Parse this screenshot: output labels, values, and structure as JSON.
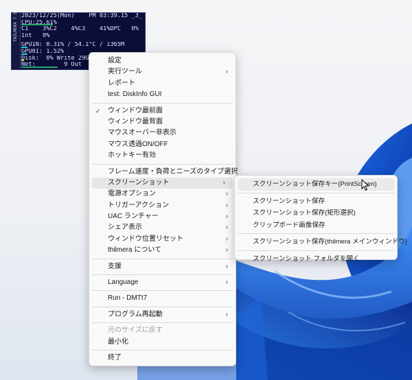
{
  "monitor": {
    "side_label": "THILMERA 7.5",
    "rows": [
      {
        "text": "2023/12/25(Mon)    PM 03:39.15 _3_"
      },
      {
        "text": "CPU:25.61%",
        "bar": 0.26,
        "color": "green"
      },
      {
        "text": "C1    3%C2    4%C3    41%DPC   0%"
      },
      {
        "text": "Int   0%"
      },
      {
        "gap": true
      },
      {
        "text": "GPU1N: 0.31% / 54.1°C / 1365M",
        "bar": 0.05,
        "color": "cyan"
      },
      {
        "text": "GPU0I: 1.52%",
        "bar": 0.05,
        "color": "cyan"
      },
      {
        "text": "Disk:  0% Write 29G",
        "bar": 0.02,
        "color": "yellow"
      },
      {
        "text": "Net:        9 Out",
        "bar": 0.3,
        "color": "green"
      }
    ]
  },
  "main_menu": [
    {
      "label": "設定"
    },
    {
      "label": "実行ツール",
      "submenu": true
    },
    {
      "label": "レポート"
    },
    {
      "label": "test: DiskInfo GUI"
    },
    {
      "sep": true
    },
    {
      "label": "ウィンドウ最前面",
      "checked": true
    },
    {
      "label": "ウィンドウ最背面"
    },
    {
      "label": "マウスオーバー非表示"
    },
    {
      "label": "マウス透過ON/OFF"
    },
    {
      "label": "ホットキー有効"
    },
    {
      "sep": true
    },
    {
      "label": "フレーム速度・負荷とニーズのタイプ選択",
      "submenu": true
    },
    {
      "label": "スクリーンショット",
      "submenu": true,
      "highlight": true
    },
    {
      "label": "電源オプション",
      "submenu": true
    },
    {
      "label": "トリガーアクション",
      "submenu": true
    },
    {
      "label": "UAC ランチャー",
      "submenu": true
    },
    {
      "label": "シェア表示",
      "submenu": true
    },
    {
      "label": "ウィンドウ位置リセット",
      "submenu": true
    },
    {
      "label": "thilmera について",
      "submenu": true
    },
    {
      "sep": true
    },
    {
      "label": "支援",
      "submenu": true
    },
    {
      "sep": true
    },
    {
      "label": "Language",
      "submenu": true
    },
    {
      "sep": true
    },
    {
      "label": "Run - DMTt7"
    },
    {
      "sep": true
    },
    {
      "label": "プログラム再起動",
      "submenu": true
    },
    {
      "sep": true
    },
    {
      "label": "元のサイズに戻す",
      "disabled": true
    },
    {
      "label": "最小化"
    },
    {
      "sep": true
    },
    {
      "label": "終了"
    }
  ],
  "sub_menu": [
    {
      "label": "スクリーンショット保存キー(PrintScreen)",
      "highlight": true
    },
    {
      "sep": true
    },
    {
      "label": "スクリーンショット保存"
    },
    {
      "label": "スクリーンショット保存(矩形選択)"
    },
    {
      "label": "クリップボード画像保存"
    },
    {
      "sep": true
    },
    {
      "label": "スクリーンショット保存(thilmera メインウィンドウ)"
    },
    {
      "sep": true
    },
    {
      "label": "スクリーンショット フォルダを開く"
    }
  ],
  "icons": {
    "submenu_arrow": "chevron-right-icon",
    "check": "checkmark-icon",
    "cursor": "mouse-pointer-icon"
  },
  "colors": {
    "bar_green": "#21a86b",
    "bar_cyan": "#2ec5d9",
    "bar_yellow": "#d9c92e",
    "monitor_bg": "#0a0e38"
  }
}
